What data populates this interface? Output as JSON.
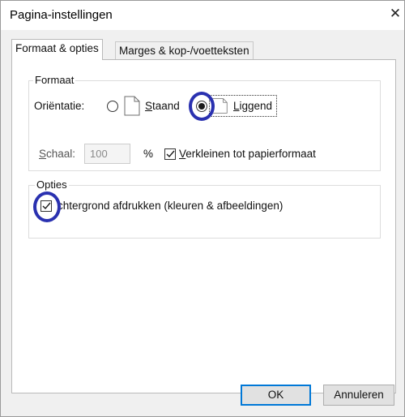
{
  "dialog": {
    "title": "Pagina-instellingen",
    "close_glyph": "✕"
  },
  "tabs": [
    {
      "label": "Formaat & opties",
      "active": true
    },
    {
      "label": "Marges & kop-/voetteksten",
      "active": false
    }
  ],
  "format_group": {
    "legend": "Formaat",
    "orientation_label": "Oriëntatie:",
    "orientation_options": [
      {
        "label": "Staand",
        "mnemonic": "S",
        "rest": "taand",
        "selected": false,
        "icon": "portrait-page-icon"
      },
      {
        "label": "Liggend",
        "mnemonic": "L",
        "rest": "iggend",
        "selected": true,
        "icon": "landscape-page-icon"
      }
    ],
    "scale_label": "Schaal:",
    "scale_mnemonic": "S",
    "scale_rest": "chaal:",
    "scale_value": "100",
    "percent_sign": "%",
    "shrink_label": "Verkleinen tot papierformaat",
    "shrink_mnemonic": "V",
    "shrink_rest": "erkleinen tot papierformaat",
    "shrink_checked": true
  },
  "options_group": {
    "legend": "Opties",
    "print_background_label": "Achtergrond afdrukken (kleuren & afbeeldingen)",
    "print_background_visible": "chtergrond afdrukken (kleuren & afbeeldingen)",
    "print_background_checked": true
  },
  "buttons": {
    "ok": "OK",
    "cancel": "Annuleren"
  },
  "colors": {
    "highlight_circle": "#2a31b0",
    "default_button_border": "#0078d7"
  }
}
